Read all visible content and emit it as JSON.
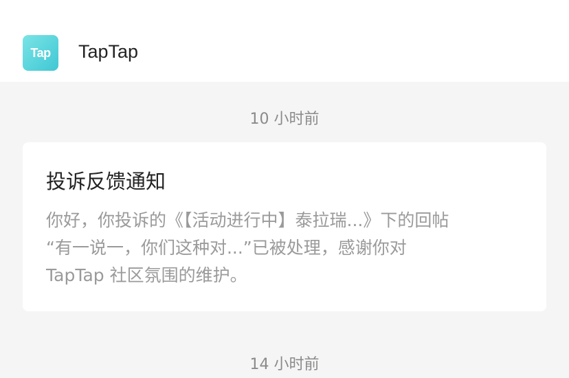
{
  "app": {
    "icon_text": "Tap",
    "name": "TapTap"
  },
  "messages": [
    {
      "timestamp": "10 小时前",
      "title": "投诉反馈通知",
      "body_lines": [
        "你好，你投诉的《【活动进行中】泰拉瑞...》下的回帖",
        "“有一说一，你们这种对...”已被处理，感谢你对",
        "TapTap 社区氛围的维护。"
      ]
    },
    {
      "timestamp": "14 小时前"
    }
  ],
  "colors": {
    "icon_gradient_start": "#7ae4e6",
    "icon_gradient_end": "#3fc7d3",
    "background": "#f5f5f5",
    "card": "#ffffff"
  }
}
